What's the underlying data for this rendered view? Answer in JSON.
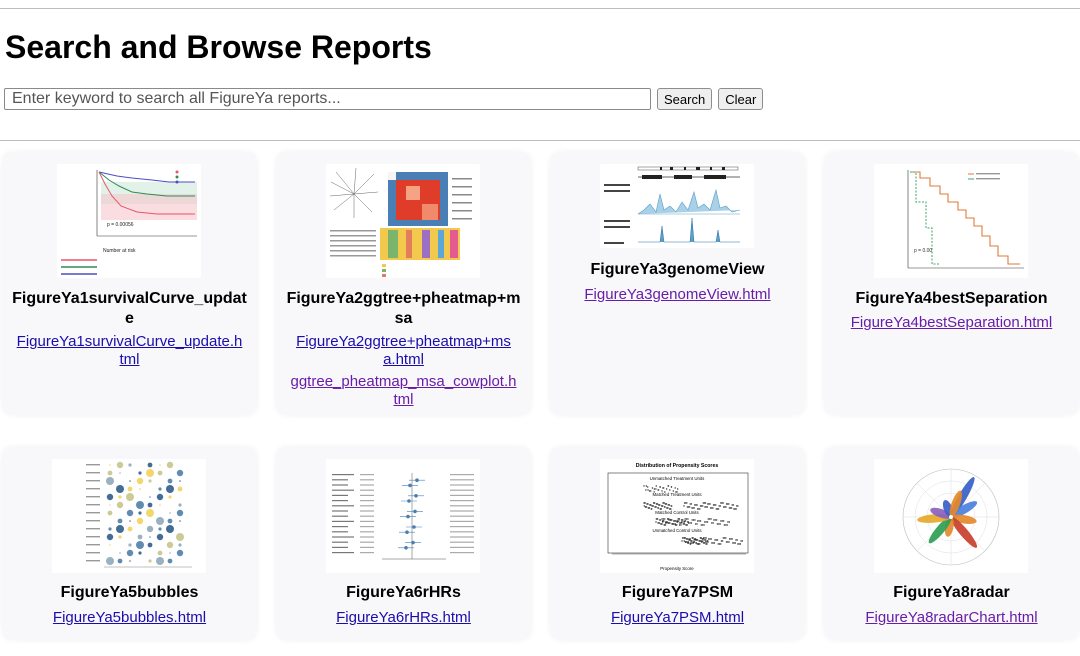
{
  "page": {
    "heading": "Search and Browse Reports"
  },
  "search": {
    "placeholder": "Enter keyword to search all FigureYa reports...",
    "search_label": "Search",
    "clear_label": "Clear"
  },
  "reports": [
    {
      "title": "FigureYa1survivalCurve_update",
      "links": [
        "FigureYa1survivalCurve_update.html"
      ]
    },
    {
      "title": "FigureYa2ggtree+pheatmap+msa",
      "links": [
        "FigureYa2ggtree+pheatmap+msa.html",
        "ggtree_pheatmap_msa_cowplot.html"
      ]
    },
    {
      "title": "FigureYa3genomeView",
      "links": [
        "FigureYa3genomeView.html"
      ]
    },
    {
      "title": "FigureYa4bestSeparation",
      "links": [
        "FigureYa4bestSeparation.html"
      ]
    },
    {
      "title": "FigureYa5bubbles",
      "links": [
        "FigureYa5bubbles.html"
      ]
    },
    {
      "title": "FigureYa6rHRs",
      "links": [
        "FigureYa6rHRs.html"
      ]
    },
    {
      "title": "FigureYa7PSM",
      "links": [
        "FigureYa7PSM.html"
      ]
    },
    {
      "title": "FigureYa8radar",
      "links": [
        "FigureYa8radarChart.html"
      ]
    }
  ],
  "thumbnails": {
    "psm_title": "Distribution of Propensity Scores",
    "psm_row1": "Unmatched Treatment Units",
    "psm_row2": "Matched Treatment Units",
    "psm_row3": "Matched Control Units",
    "psm_row4": "Unmatched Control Units",
    "psm_xlabel": "Propensity Score",
    "survival_pvalue": "p = 0.00056",
    "survival_risk": "Number at risk",
    "best_pvalue": "p = 0.00"
  },
  "colors": {
    "link": "#1a0dab",
    "visited_link": "#681da8",
    "card_bg": "#f8f8fb"
  }
}
